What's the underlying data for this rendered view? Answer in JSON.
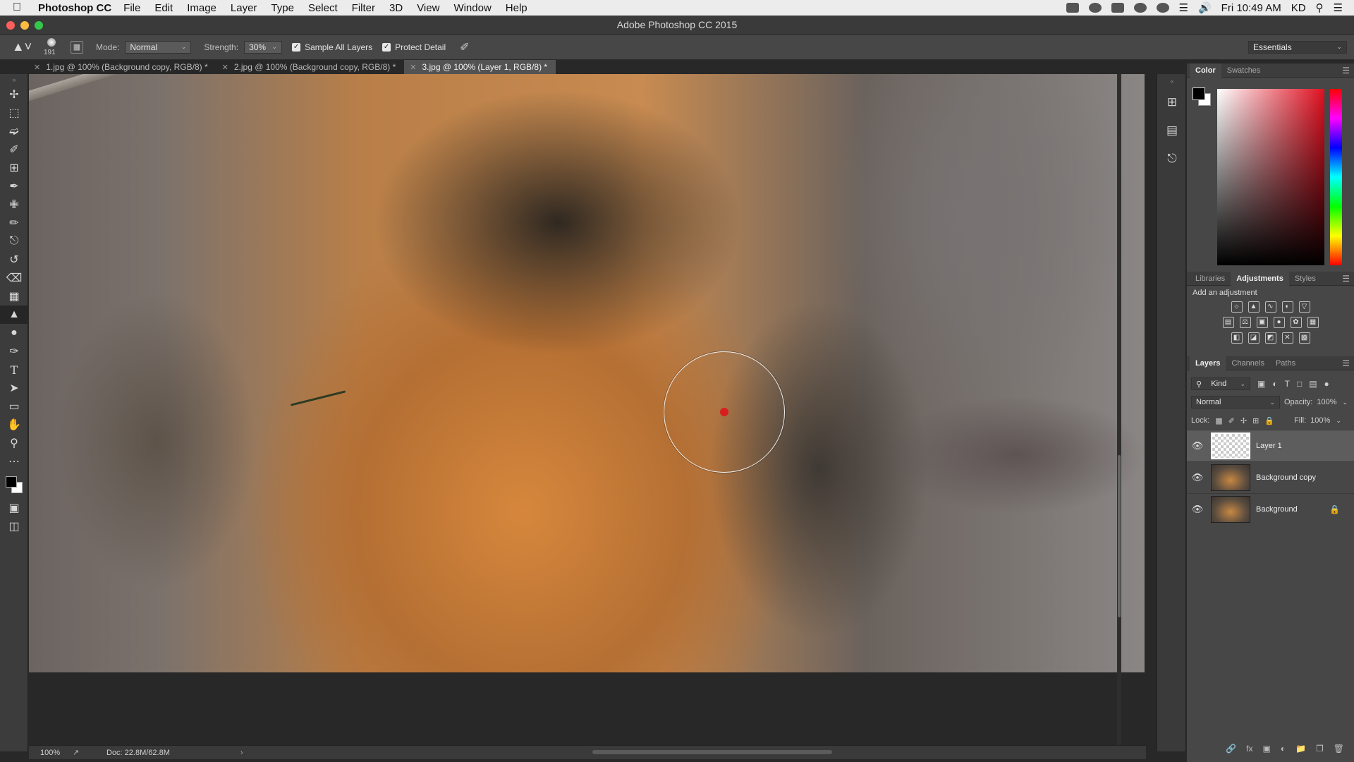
{
  "menubar": {
    "app_name": "Photoshop CC",
    "items": [
      "File",
      "Edit",
      "Image",
      "Layer",
      "Type",
      "Select",
      "Filter",
      "3D",
      "View",
      "Window",
      "Help"
    ],
    "clock": "Fri 10:49 AM",
    "user": "KD"
  },
  "window": {
    "title": "Adobe Photoshop CC 2015"
  },
  "options": {
    "brush_size": "191",
    "mode_label": "Mode:",
    "mode_value": "Normal",
    "strength_label": "Strength:",
    "strength_value": "30%",
    "sample_all_layers": "Sample All Layers",
    "protect_detail": "Protect Detail",
    "workspace": "Essentials"
  },
  "tabs": [
    {
      "label": "1.jpg @ 100% (Background copy, RGB/8) *"
    },
    {
      "label": "2.jpg @ 100% (Background copy, RGB/8) *"
    },
    {
      "label": "3.jpg @ 100% (Layer 1, RGB/8) *"
    }
  ],
  "status": {
    "zoom": "100%",
    "doc": "Doc: 22.8M/62.8M"
  },
  "color_panel": {
    "tab_color": "Color",
    "tab_swatches": "Swatches"
  },
  "adjust_panel": {
    "tab_libraries": "Libraries",
    "tab_adjustments": "Adjustments",
    "tab_styles": "Styles",
    "heading": "Add an adjustment"
  },
  "layers_panel": {
    "tab_layers": "Layers",
    "tab_channels": "Channels",
    "tab_paths": "Paths",
    "kind": "Kind",
    "blend_mode": "Normal",
    "opacity_label": "Opacity:",
    "opacity_value": "100%",
    "lock_label": "Lock:",
    "fill_label": "Fill:",
    "fill_value": "100%",
    "layers": [
      {
        "name": "Layer 1"
      },
      {
        "name": "Background copy"
      },
      {
        "name": "Background"
      }
    ]
  },
  "colors": {
    "accent_brush_dot": "#d81e1e",
    "fg": "#000000",
    "bg": "#ffffff"
  }
}
